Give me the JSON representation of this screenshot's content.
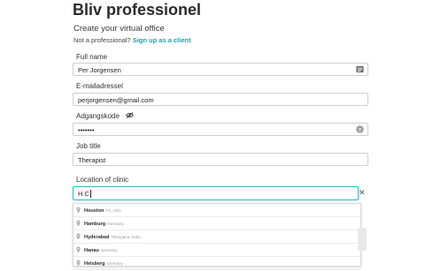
{
  "page": {
    "title": "Bliv professionel",
    "subtitle": "Create your virtual office",
    "client_prompt": "Not a professional?",
    "client_link": "Sign up as a client"
  },
  "form": {
    "full_name": {
      "label": "Full name",
      "value": "Per Jorgensen",
      "icon": "contact-card-icon"
    },
    "email": {
      "label": "E-mailadressel",
      "value": "perjorgensen@gmail.com"
    },
    "password": {
      "label": "Adgangskode",
      "value": "•••••••",
      "icon": "eye-off-icon",
      "trailing_icon": "fingerprint-icon"
    },
    "job_title": {
      "label": "Job title",
      "value": "Therapist"
    },
    "location": {
      "label": "Location of clinic",
      "value": "H.C",
      "clear_icon": "close-icon"
    }
  },
  "suggestions": [
    {
      "main": "Houston",
      "secondary": "TX, USA"
    },
    {
      "main": "Hamburg",
      "secondary": "Germany"
    },
    {
      "main": "Hyderabad",
      "secondary": "Telangana, India"
    },
    {
      "main": "Hanau",
      "secondary": "Germany"
    },
    {
      "main": "Heisberg",
      "secondary": "Germany"
    }
  ],
  "colors": {
    "accent": "#1aa3b0",
    "focus_border": "#2bb6c2"
  }
}
